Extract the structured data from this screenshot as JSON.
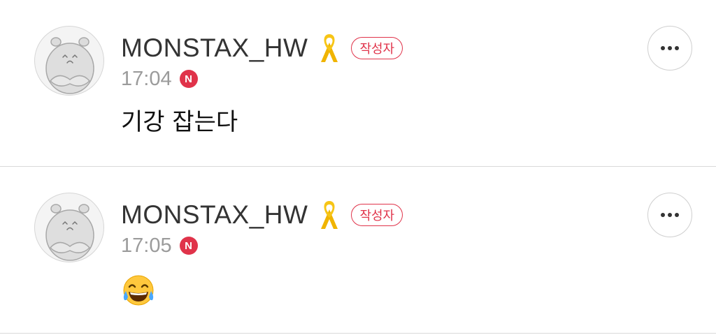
{
  "comments": [
    {
      "author": "MONSTAX_HW",
      "ribbon_icon": "yellow-ribbon-icon",
      "badge": "작성자",
      "time": "17:04",
      "new_badge": "N",
      "text": "기강 잡는다"
    },
    {
      "author": "MONSTAX_HW",
      "ribbon_icon": "yellow-ribbon-icon",
      "badge": "작성자",
      "time": "17:05",
      "new_badge": "N",
      "emoji": "face-with-tears-of-joy-emoji"
    }
  ],
  "colors": {
    "accent": "#e0334a",
    "ribbon": "#f0b400",
    "name": "#333333",
    "time": "#9b9b9b",
    "divider": "#d9d9d9"
  }
}
